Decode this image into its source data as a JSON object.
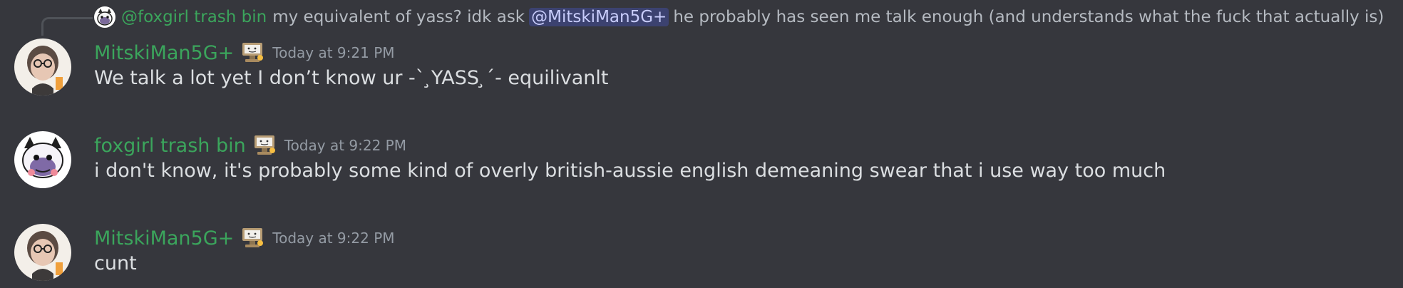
{
  "reply": {
    "author": "@foxgirl trash bin",
    "text_before": "my equivalent of yass? idk ask",
    "mention": "@MitskiMan5G+",
    "text_after": "he probably has seen me talk enough (and understands what the fuck that actually is)"
  },
  "messages": [
    {
      "username": "MitskiMan5G+",
      "timestamp": "Today at 9:21 PM",
      "content": "We talk a lot yet I don’t know ur -` ̧YASS ̧´- equilivanlt",
      "username_color": "#3ba55c",
      "role_icon": "thinking-computer-emoji-icon",
      "avatar_icon": "person-photo-avatar"
    },
    {
      "username": "foxgirl trash bin",
      "timestamp": "Today at 9:22 PM",
      "content": "i don't know, it's probably some kind of overly british-aussie english demeaning swear that i use way too much",
      "username_color": "#3ba55c",
      "role_icon": "thinking-computer-emoji-icon",
      "avatar_icon": "cartoon-fox-avatar"
    },
    {
      "username": "MitskiMan5G+",
      "timestamp": "Today at 9:22 PM",
      "content": "cunt",
      "username_color": "#3ba55c",
      "role_icon": "thinking-computer-emoji-icon",
      "avatar_icon": "person-photo-avatar"
    }
  ],
  "colors": {
    "background": "#36373d",
    "username": "#3ba55c",
    "message_text": "#dbdee1",
    "timestamp": "#949ba4",
    "mention_bg": "#3c4270",
    "mention_text": "#c9cdfb"
  }
}
